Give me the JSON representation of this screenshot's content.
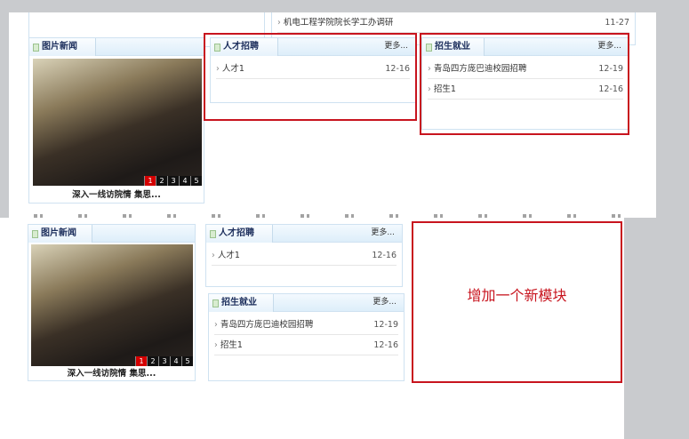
{
  "top": {
    "news_item": {
      "title": "机电工程学院院长学工办调研",
      "date": "11-27"
    },
    "photo_news": {
      "title": "图片新闻",
      "pages": [
        "1",
        "2",
        "3",
        "4",
        "5"
      ],
      "caption": "深入一线访院情 集思..."
    },
    "talent": {
      "title": "人才招聘",
      "more": "更多...",
      "items": [
        {
          "title": "人才1",
          "date": "12-16"
        }
      ]
    },
    "enroll": {
      "title": "招生就业",
      "more": "更多...",
      "items": [
        {
          "title": "青岛四方庞巴迪校园招聘",
          "date": "12-19"
        },
        {
          "title": "招生1",
          "date": "12-16"
        }
      ]
    }
  },
  "bottom": {
    "photo_news": {
      "title": "图片新闻",
      "pages": [
        "1",
        "2",
        "3",
        "4",
        "5"
      ],
      "caption": "深入一线访院情 集思..."
    },
    "talent": {
      "title": "人才招聘",
      "more": "更多...",
      "items": [
        {
          "title": "人才1",
          "date": "12-16"
        }
      ]
    },
    "enroll": {
      "title": "招生就业",
      "more": "更多...",
      "items": [
        {
          "title": "青岛四方庞巴迪校园招聘",
          "date": "12-19"
        },
        {
          "title": "招生1",
          "date": "12-16"
        }
      ]
    },
    "new_module_label": "增加一个新模块"
  },
  "colors": {
    "highlight": "#c8141e",
    "active_page": "#d40000"
  }
}
